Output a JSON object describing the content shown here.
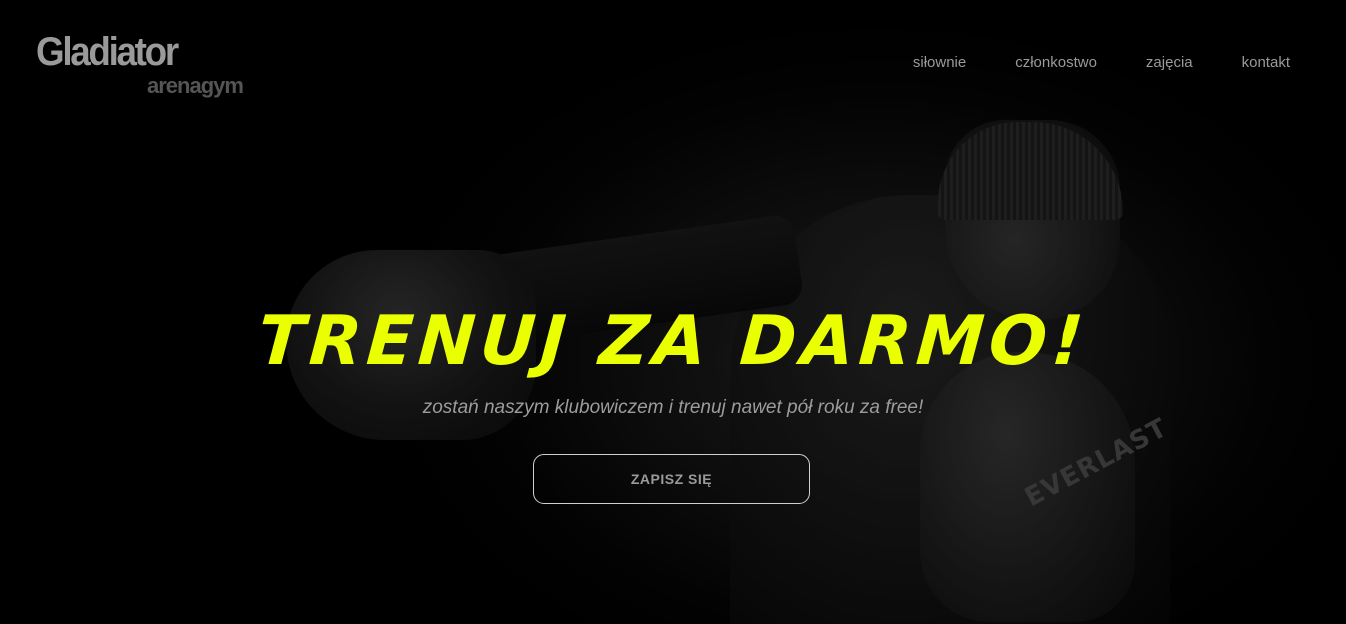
{
  "logo": {
    "main": "Gladiator",
    "sub": "arenagym"
  },
  "nav": {
    "items": [
      {
        "label": "siłownie"
      },
      {
        "label": "członkostwo"
      },
      {
        "label": "zajęcia"
      },
      {
        "label": "kontakt"
      }
    ]
  },
  "hero": {
    "headline": "TRENUJ ZA DARMO!",
    "subline": "zostań naszym klubowiczem i trenuj nawet pół roku za free!",
    "cta_label": "ZAPISZ SIĘ",
    "glove_brand": "EVERLAST"
  },
  "colors": {
    "accent": "#eaff00",
    "background": "#000000",
    "nav_text": "#9a9a9a"
  }
}
